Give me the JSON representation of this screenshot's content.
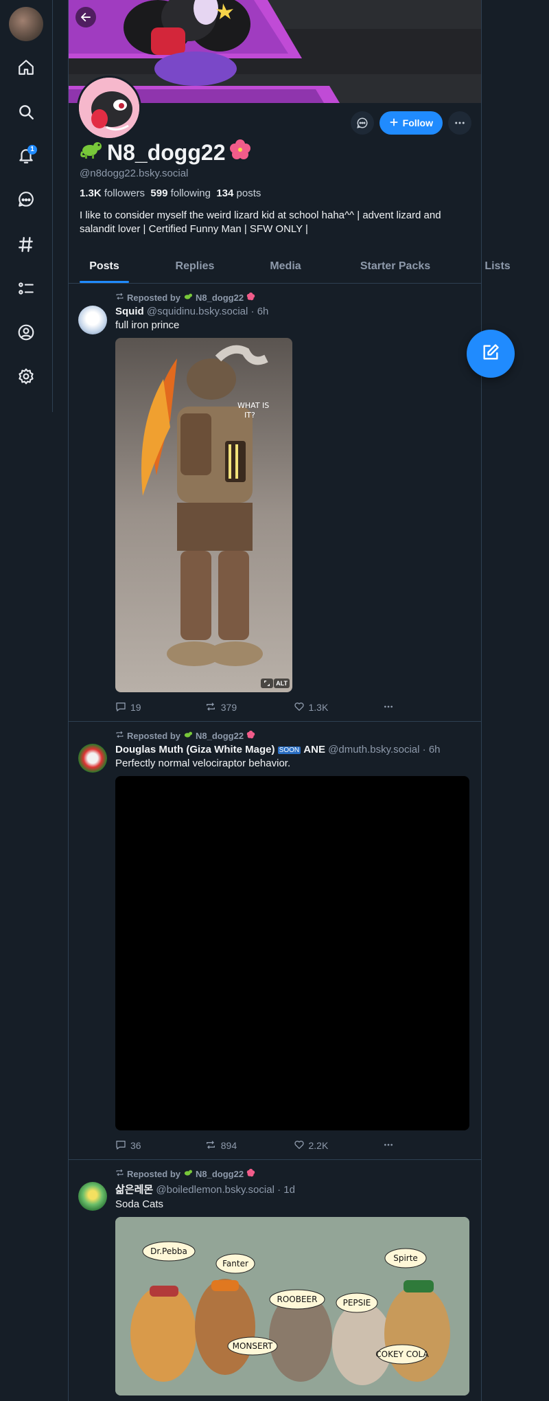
{
  "notifications_count": "1",
  "profile": {
    "display_name": "N8_dogg22",
    "handle": "@n8dogg22.bsky.social",
    "followers_count": "1.3K",
    "followers_label": "followers",
    "following_count": "599",
    "following_label": "following",
    "posts_count": "134",
    "posts_label": "posts",
    "bio": "I like to consider myself the weird lizard kid at school haha^^ | advent lizard and salandit lover | Certified Funny Man | SFW ONLY |",
    "follow_label": "Follow"
  },
  "tabs": [
    "Posts",
    "Replies",
    "Media",
    "Starter Packs",
    "Lists"
  ],
  "posts": [
    {
      "repost_label": "Reposted by",
      "reposter": "N8_dogg22",
      "author_name": "Squid",
      "author_handle": "@squidinu.bsky.social",
      "time": "· 6h",
      "text": "full iron prince",
      "image_text_1": "WHAT IS IT?",
      "alt_badge": "ALT",
      "replies": "19",
      "reposts": "379",
      "likes": "1.3K"
    },
    {
      "repost_label": "Reposted by",
      "reposter": "N8_dogg22",
      "author_name": "Douglas Muth (Giza White Mage)",
      "author_badge": "SOON",
      "author_name_suffix": "ANE",
      "author_handle": "@dmuth.bsky.social",
      "time": "· 6h",
      "text": "Perfectly normal velociraptor behavior.",
      "replies": "36",
      "reposts": "894",
      "likes": "2.2K"
    },
    {
      "repost_label": "Reposted by",
      "reposter": "N8_dogg22",
      "author_name": "삶은레몬",
      "author_handle": "@boiledlemon.bsky.social",
      "time": "· 1d",
      "text": "Soda Cats",
      "bubbles": [
        "Dr.Pebba",
        "Fanter",
        "ROOBEER",
        "PEPSIE",
        "Spirte",
        "MONSERT",
        "COKEY COLA"
      ]
    }
  ]
}
